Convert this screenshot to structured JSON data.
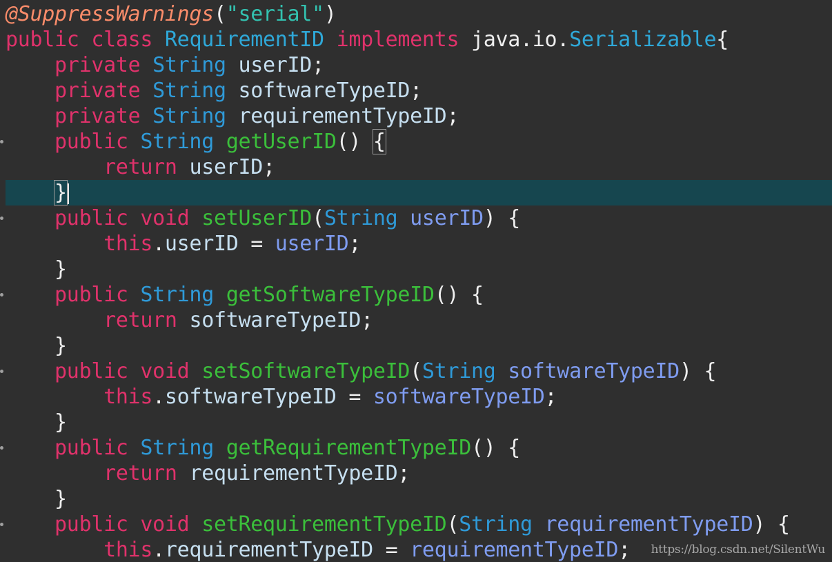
{
  "colors": {
    "background": "#2f2f2f",
    "current_line": "#16464f",
    "annotation": "#fa8c6a",
    "keyword": "#e0326b",
    "type": "#2f9ad8",
    "class_name": "#2fa8d8",
    "method": "#3bbf3b",
    "parameter": "#7f9cf0",
    "field": "#c6dff0",
    "string": "#33c2b0",
    "plain": "#eeeeee",
    "punctuation": "#eeeeee"
  },
  "code_lines": [
    {
      "tokens": [
        {
          "t": "@SuppressWarnings",
          "c": "annotation"
        },
        {
          "t": "(",
          "c": "punctuation"
        },
        {
          "t": "\"serial\"",
          "c": "string"
        },
        {
          "t": ")",
          "c": "punctuation"
        }
      ]
    },
    {
      "tokens": [
        {
          "t": "public",
          "c": "keyword"
        },
        {
          "t": " ",
          "c": "plain"
        },
        {
          "t": "class",
          "c": "keyword"
        },
        {
          "t": " ",
          "c": "plain"
        },
        {
          "t": "RequirementID",
          "c": "class_name"
        },
        {
          "t": " ",
          "c": "plain"
        },
        {
          "t": "implements",
          "c": "keyword"
        },
        {
          "t": " java.io.",
          "c": "plain"
        },
        {
          "t": "Serializable",
          "c": "class_name"
        },
        {
          "t": "{",
          "c": "punctuation"
        }
      ]
    },
    {
      "tokens": [
        {
          "t": "    ",
          "c": "plain"
        },
        {
          "t": "private",
          "c": "keyword"
        },
        {
          "t": " ",
          "c": "plain"
        },
        {
          "t": "String",
          "c": "type"
        },
        {
          "t": " ",
          "c": "plain"
        },
        {
          "t": "userID",
          "c": "field"
        },
        {
          "t": ";",
          "c": "punctuation"
        }
      ]
    },
    {
      "tokens": [
        {
          "t": "    ",
          "c": "plain"
        },
        {
          "t": "private",
          "c": "keyword"
        },
        {
          "t": " ",
          "c": "plain"
        },
        {
          "t": "String",
          "c": "type"
        },
        {
          "t": " ",
          "c": "plain"
        },
        {
          "t": "softwareTypeID",
          "c": "field"
        },
        {
          "t": ";",
          "c": "punctuation"
        }
      ]
    },
    {
      "tokens": [
        {
          "t": "    ",
          "c": "plain"
        },
        {
          "t": "private",
          "c": "keyword"
        },
        {
          "t": " ",
          "c": "plain"
        },
        {
          "t": "String",
          "c": "type"
        },
        {
          "t": " ",
          "c": "plain"
        },
        {
          "t": "requirementTypeID",
          "c": "field"
        },
        {
          "t": ";",
          "c": "punctuation"
        }
      ]
    },
    {
      "fold": true,
      "tokens": [
        {
          "t": "    ",
          "c": "plain"
        },
        {
          "t": "public",
          "c": "keyword"
        },
        {
          "t": " ",
          "c": "plain"
        },
        {
          "t": "String",
          "c": "type"
        },
        {
          "t": " ",
          "c": "plain"
        },
        {
          "t": "getUserID",
          "c": "method"
        },
        {
          "t": "() ",
          "c": "punctuation"
        },
        {
          "t": "{",
          "c": "punctuation",
          "box": true
        }
      ]
    },
    {
      "tokens": [
        {
          "t": "        ",
          "c": "plain"
        },
        {
          "t": "return",
          "c": "keyword"
        },
        {
          "t": " ",
          "c": "plain"
        },
        {
          "t": "userID",
          "c": "field"
        },
        {
          "t": ";",
          "c": "punctuation"
        }
      ]
    },
    {
      "current": true,
      "tokens": [
        {
          "t": "    ",
          "c": "plain"
        },
        {
          "t": "}",
          "c": "punctuation",
          "box": true,
          "caret": true
        }
      ]
    },
    {
      "fold": true,
      "tokens": [
        {
          "t": "    ",
          "c": "plain"
        },
        {
          "t": "public",
          "c": "keyword"
        },
        {
          "t": " ",
          "c": "plain"
        },
        {
          "t": "void",
          "c": "keyword"
        },
        {
          "t": " ",
          "c": "plain"
        },
        {
          "t": "setUserID",
          "c": "method"
        },
        {
          "t": "(",
          "c": "punctuation"
        },
        {
          "t": "String",
          "c": "type"
        },
        {
          "t": " ",
          "c": "plain"
        },
        {
          "t": "userID",
          "c": "parameter"
        },
        {
          "t": ") {",
          "c": "punctuation"
        }
      ]
    },
    {
      "tokens": [
        {
          "t": "        ",
          "c": "plain"
        },
        {
          "t": "this",
          "c": "keyword"
        },
        {
          "t": ".",
          "c": "punctuation"
        },
        {
          "t": "userID",
          "c": "field"
        },
        {
          "t": " = ",
          "c": "plain"
        },
        {
          "t": "userID",
          "c": "parameter"
        },
        {
          "t": ";",
          "c": "punctuation"
        }
      ]
    },
    {
      "tokens": [
        {
          "t": "    ",
          "c": "plain"
        },
        {
          "t": "}",
          "c": "punctuation"
        }
      ]
    },
    {
      "fold": true,
      "tokens": [
        {
          "t": "    ",
          "c": "plain"
        },
        {
          "t": "public",
          "c": "keyword"
        },
        {
          "t": " ",
          "c": "plain"
        },
        {
          "t": "String",
          "c": "type"
        },
        {
          "t": " ",
          "c": "plain"
        },
        {
          "t": "getSoftwareTypeID",
          "c": "method"
        },
        {
          "t": "() {",
          "c": "punctuation"
        }
      ]
    },
    {
      "tokens": [
        {
          "t": "        ",
          "c": "plain"
        },
        {
          "t": "return",
          "c": "keyword"
        },
        {
          "t": " ",
          "c": "plain"
        },
        {
          "t": "softwareTypeID",
          "c": "field"
        },
        {
          "t": ";",
          "c": "punctuation"
        }
      ]
    },
    {
      "tokens": [
        {
          "t": "    ",
          "c": "plain"
        },
        {
          "t": "}",
          "c": "punctuation"
        }
      ]
    },
    {
      "fold": true,
      "tokens": [
        {
          "t": "    ",
          "c": "plain"
        },
        {
          "t": "public",
          "c": "keyword"
        },
        {
          "t": " ",
          "c": "plain"
        },
        {
          "t": "void",
          "c": "keyword"
        },
        {
          "t": " ",
          "c": "plain"
        },
        {
          "t": "setSoftwareTypeID",
          "c": "method"
        },
        {
          "t": "(",
          "c": "punctuation"
        },
        {
          "t": "String",
          "c": "type"
        },
        {
          "t": " ",
          "c": "plain"
        },
        {
          "t": "softwareTypeID",
          "c": "parameter"
        },
        {
          "t": ") {",
          "c": "punctuation"
        }
      ]
    },
    {
      "tokens": [
        {
          "t": "        ",
          "c": "plain"
        },
        {
          "t": "this",
          "c": "keyword"
        },
        {
          "t": ".",
          "c": "punctuation"
        },
        {
          "t": "softwareTypeID",
          "c": "field"
        },
        {
          "t": " = ",
          "c": "plain"
        },
        {
          "t": "softwareTypeID",
          "c": "parameter"
        },
        {
          "t": ";",
          "c": "punctuation"
        }
      ]
    },
    {
      "tokens": [
        {
          "t": "    ",
          "c": "plain"
        },
        {
          "t": "}",
          "c": "punctuation"
        }
      ]
    },
    {
      "fold": true,
      "tokens": [
        {
          "t": "    ",
          "c": "plain"
        },
        {
          "t": "public",
          "c": "keyword"
        },
        {
          "t": " ",
          "c": "plain"
        },
        {
          "t": "String",
          "c": "type"
        },
        {
          "t": " ",
          "c": "plain"
        },
        {
          "t": "getRequirementTypeID",
          "c": "method"
        },
        {
          "t": "() {",
          "c": "punctuation"
        }
      ]
    },
    {
      "tokens": [
        {
          "t": "        ",
          "c": "plain"
        },
        {
          "t": "return",
          "c": "keyword"
        },
        {
          "t": " ",
          "c": "plain"
        },
        {
          "t": "requirementTypeID",
          "c": "field"
        },
        {
          "t": ";",
          "c": "punctuation"
        }
      ]
    },
    {
      "tokens": [
        {
          "t": "    ",
          "c": "plain"
        },
        {
          "t": "}",
          "c": "punctuation"
        }
      ]
    },
    {
      "fold": true,
      "tokens": [
        {
          "t": "    ",
          "c": "plain"
        },
        {
          "t": "public",
          "c": "keyword"
        },
        {
          "t": " ",
          "c": "plain"
        },
        {
          "t": "void",
          "c": "keyword"
        },
        {
          "t": " ",
          "c": "plain"
        },
        {
          "t": "setRequirementTypeID",
          "c": "method"
        },
        {
          "t": "(",
          "c": "punctuation"
        },
        {
          "t": "String",
          "c": "type"
        },
        {
          "t": " ",
          "c": "plain"
        },
        {
          "t": "requirementTypeID",
          "c": "parameter"
        },
        {
          "t": ") {",
          "c": "punctuation"
        }
      ]
    },
    {
      "tokens": [
        {
          "t": "        ",
          "c": "plain"
        },
        {
          "t": "this",
          "c": "keyword"
        },
        {
          "t": ".",
          "c": "punctuation"
        },
        {
          "t": "requirementTypeID",
          "c": "field"
        },
        {
          "t": " = ",
          "c": "plain"
        },
        {
          "t": "requirementTypeID",
          "c": "parameter"
        },
        {
          "t": ";",
          "c": "punctuation"
        }
      ]
    }
  ],
  "watermark": "https://blog.csdn.net/SilentWu"
}
